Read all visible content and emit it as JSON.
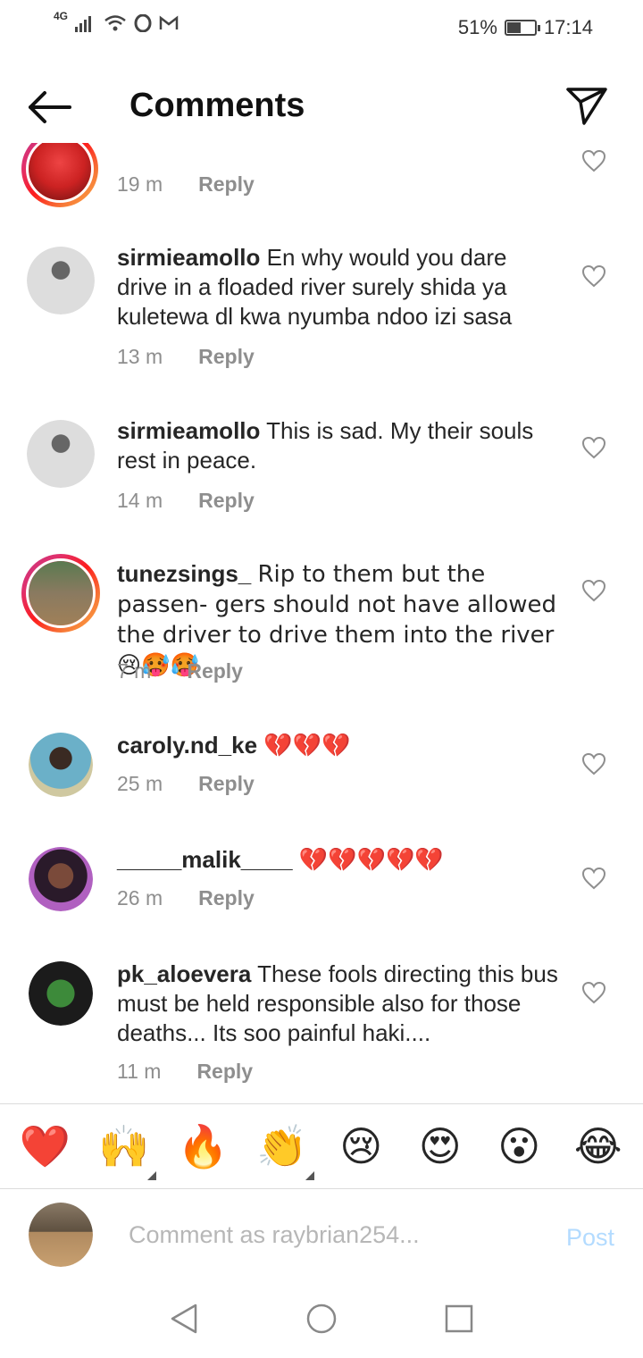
{
  "status_bar": {
    "network": "4G",
    "battery_pct_text": "51%",
    "battery_level": 0.51,
    "time": "17:14"
  },
  "header": {
    "title": "Comments"
  },
  "partial_comment": {
    "time": "19 m",
    "reply": "Reply"
  },
  "comments": [
    {
      "username": "sirmieamollo",
      "text": "En why would  you  dare drive in  a floaded river surely  shida ya kuletewa dl kwa nyumba ndoo izi sasa",
      "time": "13 m",
      "reply": "Reply"
    },
    {
      "username": "sirmieamollo",
      "text": "This is sad. My their souls rest in peace.",
      "time": "14 m",
      "reply": "Reply"
    },
    {
      "username": "tunezsings_",
      "text": "Rip to them but the passen- gers should not have allowed the driver to drive them into the river 😢🥵🥵",
      "time": "7 m",
      "reply": "Reply"
    },
    {
      "username": "caroly.nd_ke",
      "text": "💔💔💔",
      "time": "25 m",
      "reply": "Reply"
    },
    {
      "username": "_____malik____",
      "text": "💔💔💔💔💔",
      "time": "26 m",
      "reply": "Reply"
    },
    {
      "username": "pk_aloevera",
      "text": "These fools directing this bus must be held responsible also for those deaths... Its soo painful haki....",
      "time": "11 m",
      "reply": "Reply"
    }
  ],
  "reactions": [
    "❤️",
    "🙌",
    "🔥",
    "👏",
    "😢",
    "😍",
    "😮",
    "😂"
  ],
  "composer": {
    "placeholder": "Comment as raybrian254...",
    "post_label": "Post"
  },
  "colors": {
    "accent_disabled": "#b3dbff",
    "meta_gray": "#8e8e8e",
    "story_ring": "#e1306c"
  }
}
